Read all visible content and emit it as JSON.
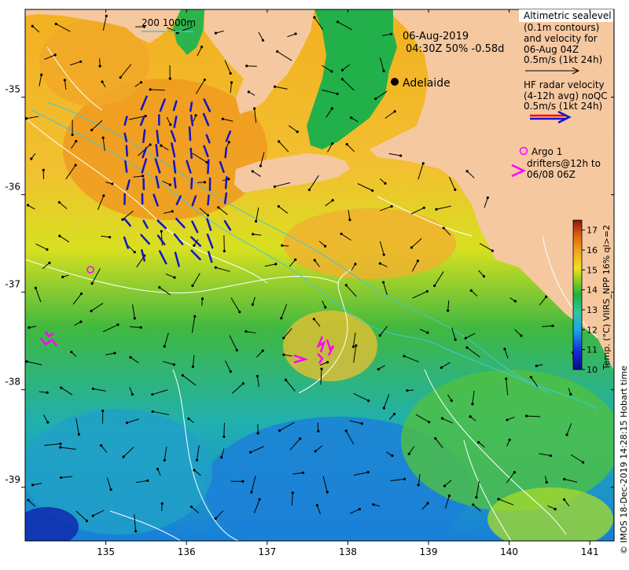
{
  "header": {
    "date": "06-Aug-2019",
    "time_line": "04:30Z  50% -0.58d"
  },
  "scale_bar": {
    "label": "200  1000m"
  },
  "places": [
    {
      "name": "Adelaide"
    }
  ],
  "legend": {
    "altimetric": {
      "lines": [
        "Altimetric sealevel",
        "(0.1m contours)",
        "and velocity for",
        "06-Aug 04Z",
        "0.5m/s (1kt 24h)"
      ]
    },
    "hf_radar": {
      "lines": [
        "HF radar velocity",
        "(4-12h avg) noQC",
        "0.5m/s (1kt 24h)"
      ]
    },
    "argo": {
      "label": "Argo 1"
    },
    "drifters": {
      "lines": [
        "drifters@12h to",
        "06/08 06Z"
      ]
    }
  },
  "colorbar": {
    "label": "Temp. (°C) VIIRS_NPP 16% ql>=2",
    "min": 10,
    "max": 17.5,
    "ticks": [
      "10",
      "11",
      "12",
      "13",
      "14",
      "15",
      "16",
      "17"
    ]
  },
  "axes": {
    "x_ticks": [
      "135",
      "136",
      "137",
      "138",
      "139",
      "140",
      "141"
    ],
    "y_ticks": [
      "-35",
      "-36",
      "-37",
      "-38",
      "-39"
    ],
    "lon_range": [
      134,
      141.3
    ],
    "lat_range": [
      -39.55,
      -34.1
    ]
  },
  "credit": "© IMOS 18-Dec-2019 14:28:15 Hobart time",
  "colors": {
    "land": "#f5c8a0",
    "land_green": "#22b04a",
    "sst_warm": "#f08020",
    "sst_mid": "#e6e02a",
    "sst_cool": "#1fb04c",
    "sst_cold": "#1c7fd0",
    "radar_arrow": "#1414c8",
    "argo": "#ff00ff",
    "drifter": "#ff00ff",
    "contour": "#ffffff",
    "bathy": "#40c8d8"
  }
}
